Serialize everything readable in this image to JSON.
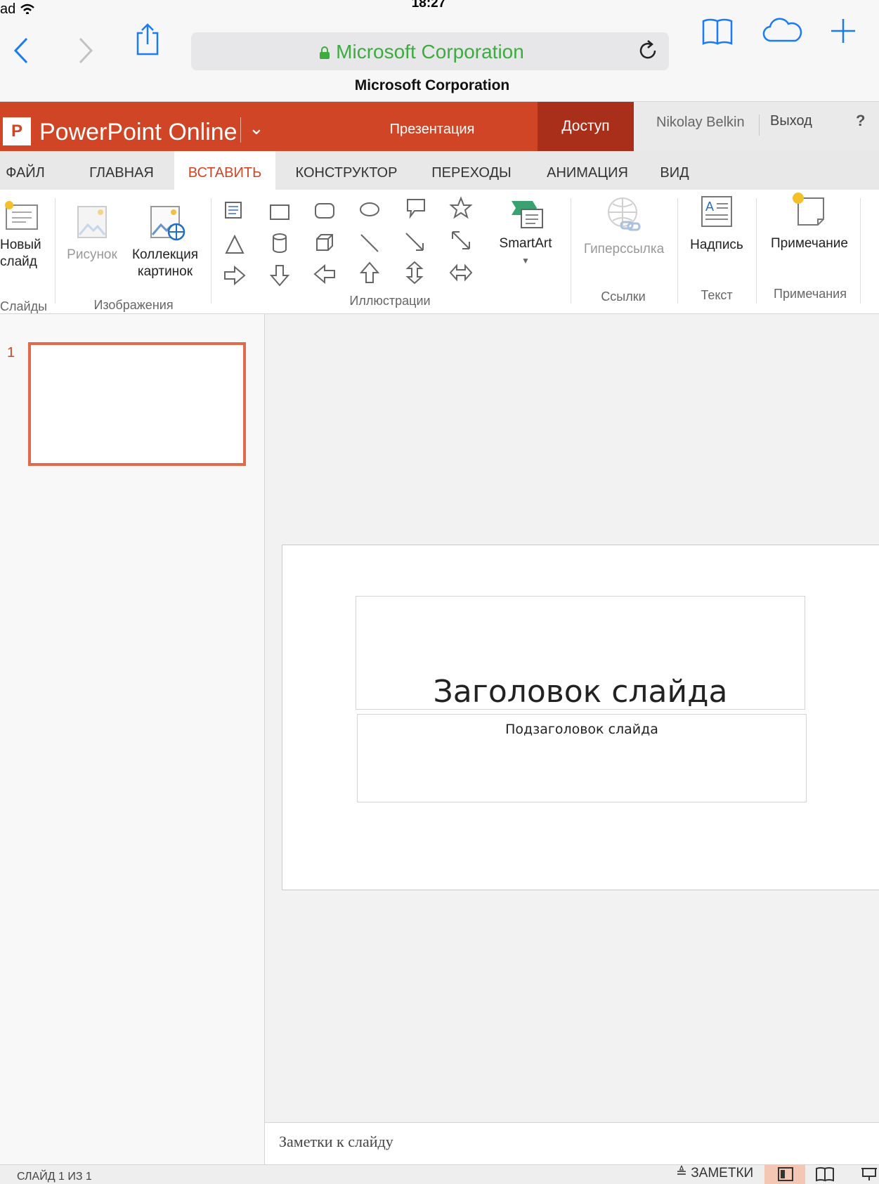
{
  "device_status": {
    "carrier": "ad",
    "time": "18:27"
  },
  "browser": {
    "url_text": "Microsoft Corporation",
    "page_title": "Microsoft Corporation"
  },
  "app": {
    "name": "PowerPoint Online",
    "presentation_label": "Презентация",
    "access_label": "Доступ",
    "user_name": "Nikolay Belkin",
    "logout_label": "Выход",
    "help_label": "?"
  },
  "tabs": [
    {
      "label": "ФАЙЛ"
    },
    {
      "label": "ГЛАВНАЯ"
    },
    {
      "label": "ВСТАВИТЬ",
      "active": true
    },
    {
      "label": "КОНСТРУКТОР"
    },
    {
      "label": "ПЕРЕХОДЫ"
    },
    {
      "label": "АНИМАЦИЯ"
    },
    {
      "label": "ВИД"
    }
  ],
  "ribbon": {
    "new_slide": "Новый слайд",
    "picture": "Рисунок",
    "clipart": "Коллекция картинок",
    "smartart": "SmartArt",
    "hyperlink": "Гиперссылка",
    "textbox": "Надпись",
    "comment": "Примечание",
    "groups": {
      "slides": "Слайды",
      "images": "Изображения",
      "illustrations": "Иллюстрации",
      "links": "Ссылки",
      "text": "Текст",
      "comments": "Примечания"
    }
  },
  "slides_pane": {
    "thumb_number": "1"
  },
  "slide": {
    "title": "Заголовок слайда",
    "subtitle": "Подзаголовок слайда"
  },
  "notes_placeholder": "Заметки к слайду",
  "statusbar": {
    "slide_count": "СЛАЙД 1 ИЗ 1",
    "notes_label": "ЗАМЕТКИ"
  },
  "colors": {
    "accent": "#d04526",
    "access_dark": "#a92f1a",
    "url_green": "#3dab3f"
  }
}
